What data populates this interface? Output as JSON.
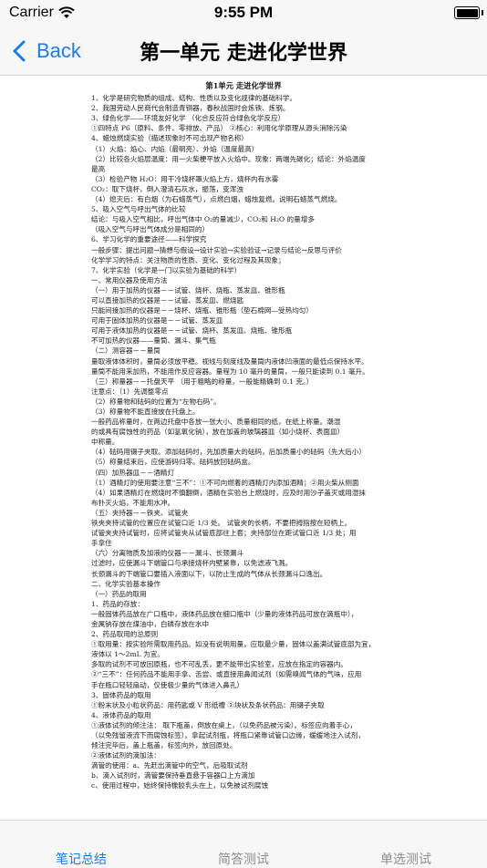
{
  "status_bar": {
    "carrier": "Carrier",
    "time": "9:55 PM"
  },
  "nav": {
    "back_label": "Back",
    "title": "第一单元 走进化学世界"
  },
  "document": {
    "title": "第1单元 走进化学世界",
    "lines": [
      "1、化学是研究物质的组成、结构、性质以及变化规律的基础科学。",
      "2、我国劳动人民商代会制造青铜器，春秋战国时会炼铁、炼钢。",
      "3、绿色化学——环境友好化学    （化合反应符合绿色化学反应）",
      "  ①四特点 P6（原料、条件、零排放、产品）     ②核心：利用化学原理从源头消除污染",
      "4、蜡烛燃烧实验（描述现象时不可出现产物名称）",
      "  （1）火焰：焰心、内焰（最明亮）、外焰（温度最高）",
      "  （2）比较各火焰层温度：用一火柴梗平放入火焰中。现象：两端先碳化；结论：外焰温度",
      "最高",
      "  （3）检验产物   H₂O：用干冷烧杯罩火焰上方，烧杯内有水雾",
      "                  CO₂：取下烧杯，倒入澄清石灰水，振荡，变浑浊",
      "  （4）熄灭后：有白烟（为石蜡蒸气），点燃白烟，蜡烛复燃。说明石蜡蒸气燃烧。",
      "5、吸入空气与呼出气体的比较",
      "  结论：与吸入空气相比，呼出气体中 O₂的量减少，CO₂和 H₂O 的量增多",
      "      （吸入空气与呼出气体成分是相同的）",
      "6、学习化学的重要途径——科学探究",
      "一般步骤：提出问题→猜想与假设→设计实验→实验验证→记录与结论→反思与评价",
      "化学学习的特点：关注物质的性质、变化、变化过程及其现象；",
      "7、化学实验（化学是一门以实验为基础的科学）",
      "  一、常用仪器及使用方法",
      "  （一）用于加热的仪器－－试管、烧杯、烧瓶、蒸发皿、锥形瓶",
      "      可以直接加热的仪器是－－试管、蒸发皿、燃烧匙",
      "      只能间接加热的仪器是－－烧杯、烧瓶、锥形瓶（垫石棉网—受热均匀）",
      "      可用于固体加热的仪器是－－试管、蒸发皿",
      "      可用于液体加热的仪器是－－试管、烧杯、蒸发皿、烧瓶、锥形瓶",
      "      不可加热的仪器——量筒、漏斗、集气瓶",
      "  （二）测容器－－量筒",
      "  量取液体体积时，量筒必须放平稳。视线与刻度线及量筒内液体凹液面的最低点保持水平。",
      "  量筒不能用来加热，不能用作反应容器。量程为 10 毫升的量筒，一般只能读到 0.1 毫升。",
      "  （三）称量器－－托盘天平     （用于粗略的称量，一般能精确到 0.1 克。）",
      "  注意点：（1）先调整零点",
      "      （2）称量物和砝码的位置为“左物右码”。",
      "      （3）称量物不能直接放在托盘上。",
      "          一般药品称量时，在两边托盘中各放一张大小、质量相同的纸，在纸上称量。潮湿",
      "          的或具有腐蚀性的药品（如氢氧化钠），放在加盖的玻璃器皿（如小烧杯、表面皿）",
      "          中称量。",
      "      （4）砝码用镊子夹取。添加砝码时，先加质量大的砝码，后加质量小的砝码（先大后小）",
      "      （5）称量结束后，应使游码归零。砝码放回砝码盒。",
      "  （四）加热器皿－－酒精灯",
      "    （1）酒精灯的使用要注意“三不”：①不可向燃着的酒精灯内添加酒精；②用火柴从侧面",
      "         （4）如果酒精灯在燃烧时不慎翻倒，酒精在实验台上燃烧时，应及时用沙子盖灭或用湿抹",
      "              布扑灭火焰，不能用水冲。",
      "        （五）夹持器－－铁夹、试管夹",
      "              铁夹夹持试管的位置应在试管口近 1/3 处。    试管夹的长柄，不要把拇指按在短柄上。",
      "              试管夹夹持试管时，应将试管夹从试管底部往上套；夹持部位在距试管口近 1/3 处；用",
      "              手拿住",
      "        （六）分离物质及加液的仪器－－漏斗、长颈漏斗",
      "              过滤时，应使漏斗下端管口与承接烧杯内壁紧靠，以免滤液飞溅。",
      "              长颈漏斗的下端管口要插入液面以下，以防止生成的气体从长颈漏斗口逸出。",
      "        二、化学实验基本操作",
      "          （一）药品的取用",
      "            1、药品的存放：",
      "              一般固体药品放在广口瓶中，液体药品放在细口瓶中（少量的液体药品可放在滴瓶中），",
      "              金属钠存放在煤油中，白磷存放在水中",
      "            2、药品取用的总原则",
      "            ①取用量：按实验所需取用药品。如没有说明用量，应取最少量，固体以盖满试管底部为宜，",
      "                 液体以 1～2mL 为宜。",
      "            多取的试剂不可放回原瓶，也不可乱丢，更不能带出实验室，应放在指定的容器内。",
      "            ②“三不”：任何药品不能用手拿、舌尝、或直接用鼻闻试剂（如需嗅闻气体的气味，应用",
      "              手在瓶口轻轻扇动，仅使极少量的气体进入鼻孔）",
      "            3、固体药品的取用",
      "            ①粉末状及小粒状药品：用药匙或 V 形纸槽          ②块状及条状药品：用镊子夹取",
      "            4、液体药品的取用",
      "            ①液体试剂的倾注法：   取下瓶盖，倒放在桌上，（以免药品被污染）。标签应向着手心，",
      "            （以免残留液流下而腐蚀标签）。拿起试剂瓶，将瓶口紧靠试管口边缘，缓缓地注入试剂，",
      "            倾注完毕后，盖上瓶盖，标签向外，放回原处。",
      "            ②液体试剂的滴加法：",
      "            滴管的使用：a、先赶出滴管中的空气，后吸取试剂",
      "                       b、滴入试剂时，滴管要保持垂直悬于容器口上方滴加",
      "                       c、使用过程中，始终保持橡胶乳头在上，以免被试剂腐蚀"
    ]
  },
  "tabs": [
    {
      "label": "笔记总结"
    },
    {
      "label": "简答测试"
    },
    {
      "label": "单选测试"
    }
  ],
  "colors": {
    "accent": "#1a7cf5",
    "inactive_tab": "#8e8e93",
    "bar_background": "#f7f7f7"
  }
}
